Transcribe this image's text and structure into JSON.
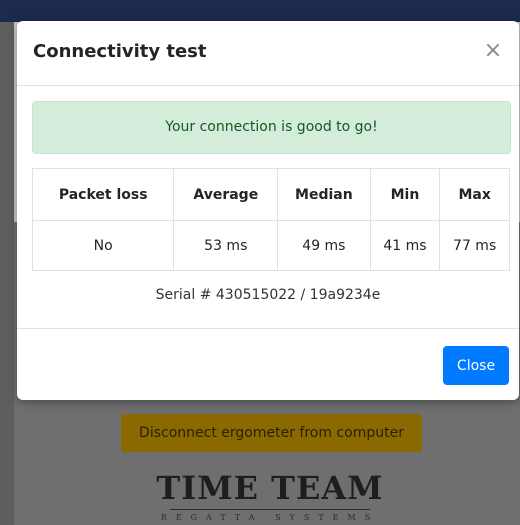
{
  "background": {
    "disconnect_button_label": "Disconnect ergometer from computer",
    "logo_main": "TIME TEAM",
    "logo_sub": "REGATTA SYSTEMS"
  },
  "modal": {
    "title": "Connectivity test",
    "close_glyph": "×",
    "alert_text": "Your connection is good to go!",
    "table": {
      "headers": [
        "Packet loss",
        "Average",
        "Median",
        "Min",
        "Max"
      ],
      "row": [
        "No",
        "53 ms",
        "49 ms",
        "41 ms",
        "77 ms"
      ]
    },
    "serial": "Serial # 430515022 / 19a9234e",
    "close_button_label": "Close"
  },
  "colors": {
    "primary": "#007bff",
    "alert_bg": "#d4edda",
    "alert_text": "#155724",
    "disconnect_bg": "#8a6a00"
  }
}
